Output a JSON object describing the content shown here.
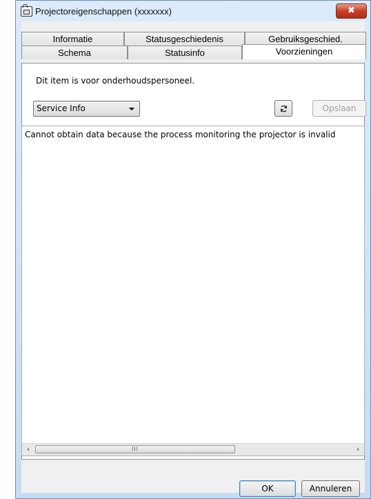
{
  "window": {
    "title": "Projectoreigenschappen (xxxxxxx)",
    "close_glyph": "✖"
  },
  "tabs": {
    "row1": [
      {
        "label": "Informatie"
      },
      {
        "label": "Statusgeschiedenis"
      },
      {
        "label": "Gebruiksgeschied."
      }
    ],
    "row2": [
      {
        "label": "Schema"
      },
      {
        "label": "Statusinfo"
      },
      {
        "label": "Voorzieningen",
        "active": true
      }
    ]
  },
  "panel": {
    "note": "Dit item is voor onderhoudspersoneel.",
    "dropdown_value": "Service Info",
    "save_label": "Opslaan",
    "output_text": "Cannot obtain data because the process monitoring the projector is invalid",
    "scroll_thumb_grip": "III"
  },
  "buttons": {
    "ok_label": "OK",
    "cancel_label": "Annuleren"
  },
  "icons": {
    "window": "projector-icon",
    "refresh": "refresh-icon"
  }
}
